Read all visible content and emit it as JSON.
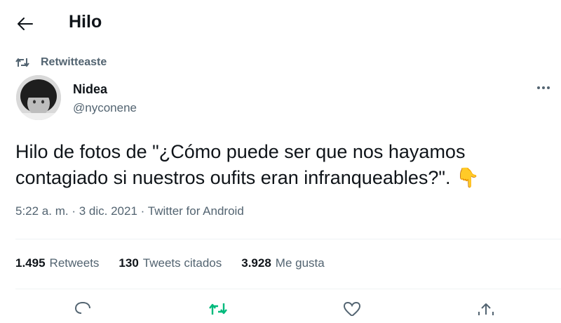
{
  "header": {
    "title": "Hilo"
  },
  "retweet_banner": {
    "label": "Retwitteaste"
  },
  "author": {
    "name": "Nidea",
    "handle": "@nyconene"
  },
  "tweet": {
    "text": "Hilo de fotos de \"¿Cómo puede ser que nos hayamos contagiado si nuestros oufits eran infranqueables?\".",
    "emoji": "👇"
  },
  "meta": {
    "time": "5:22 a. m.",
    "date": "3 dic. 2021",
    "source": "Twitter for Android",
    "sep": "·"
  },
  "stats": [
    {
      "count": "1.495",
      "label": "Retweets"
    },
    {
      "count": "130",
      "label": "Tweets citados"
    },
    {
      "count": "3.928",
      "label": "Me gusta"
    }
  ],
  "colors": {
    "text": "#0f1419",
    "secondary": "#536471",
    "retweet_active": "#00ba7c",
    "divider": "#eff3f4"
  },
  "icons": [
    "back-arrow-icon",
    "retweet-icon",
    "more-icon",
    "reply-icon",
    "retweet-icon",
    "like-icon",
    "share-icon"
  ]
}
